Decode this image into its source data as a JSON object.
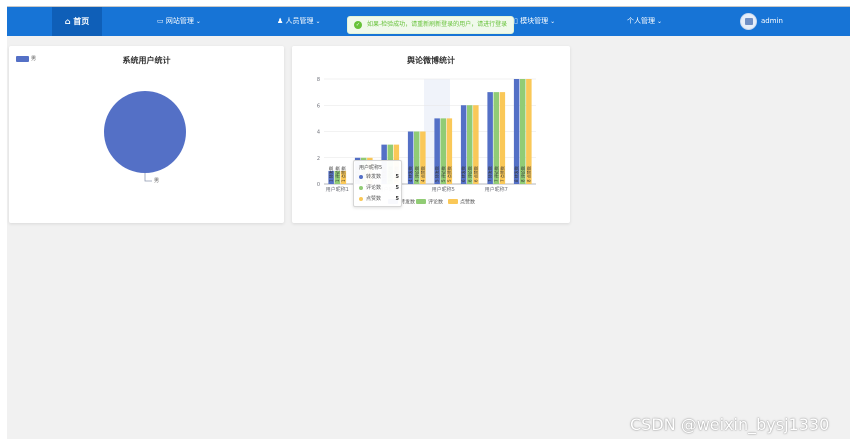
{
  "nav": {
    "home_icon": "home-icon",
    "home_label": "首页",
    "items": [
      {
        "label": "网站管理",
        "icon": "monitor-icon"
      },
      {
        "label": "人员管理",
        "icon": "user-icon"
      },
      {
        "label": "模块管理",
        "icon": "module-icon"
      },
      {
        "label": "个人管理",
        "icon": ""
      }
    ],
    "user": "admin",
    "colors": {
      "bar": "#1774d6",
      "active": "#0f5fb8"
    }
  },
  "toast": {
    "message": "如果-检验成功，请重新刷新登录的用户，请进行登录",
    "icon": "check-circle-icon",
    "color": "#67c23a"
  },
  "watermark": "CSDN @weixin_bysj1330",
  "pie_chart": {
    "title": "系统用户统计",
    "legend": "男",
    "slice_label": "男",
    "color": "#5470c6",
    "chart_data": {
      "type": "pie",
      "title": "系统用户统计",
      "slices": [
        {
          "name": "男",
          "value": 100
        }
      ]
    }
  },
  "bar_chart": {
    "title": "舆论微博统计",
    "legend": [
      {
        "name": "转发数",
        "color": "#5470c6"
      },
      {
        "name": "评论数",
        "color": "#91cc75"
      },
      {
        "name": "点赞数",
        "color": "#fac858"
      }
    ],
    "tooltip": {
      "title": "用户昵称5",
      "rows": [
        {
          "name": "转发数",
          "value": "5"
        },
        {
          "name": "评论数",
          "value": "5"
        },
        {
          "name": "点赞数",
          "value": "5"
        }
      ]
    },
    "chart_data": {
      "type": "bar",
      "title": "舆论微博统计",
      "categories": [
        "用户昵称1",
        "用户昵称2",
        "用户昵称3",
        "用户昵称4",
        "用户昵称5",
        "用户昵称6",
        "用户昵称7",
        "用户昵称8"
      ],
      "x_tick_labels": [
        "用户昵称1",
        "用户昵称3",
        "用户昵称5",
        "用户昵称7"
      ],
      "series": [
        {
          "name": "转发数",
          "values": [
            1,
            2,
            3,
            4,
            5,
            6,
            7,
            8
          ]
        },
        {
          "name": "评论数",
          "values": [
            1,
            2,
            3,
            4,
            5,
            6,
            7,
            8
          ]
        },
        {
          "name": "点赞数",
          "values": [
            1,
            2,
            3,
            4,
            5,
            6,
            7,
            8
          ]
        }
      ],
      "ylim": [
        0,
        8
      ],
      "yticks": [
        0,
        2,
        4,
        6,
        8
      ],
      "grid": true
    }
  }
}
